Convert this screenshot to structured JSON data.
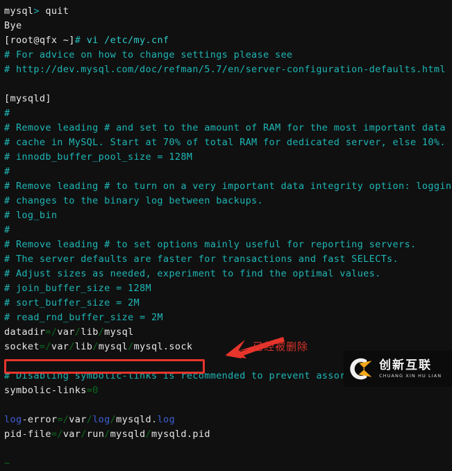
{
  "terminal": {
    "background_color": "#101010",
    "colors": {
      "white": "#e8e8e8",
      "teal_comment": "#1fb7b7",
      "cyan": "#2ecccc",
      "green_separator": "#0c6b1d",
      "blue_keyword": "#3f5fd6",
      "annotation_red": "#e8352c"
    },
    "lines": [
      {
        "id": "l01",
        "segments": [
          {
            "t": "mysql",
            "c": "white"
          },
          {
            "t": ">",
            "c": "teal"
          },
          {
            "t": " quit",
            "c": "white"
          }
        ]
      },
      {
        "id": "l02",
        "segments": [
          {
            "t": "Bye",
            "c": "white"
          }
        ]
      },
      {
        "id": "l03",
        "segments": [
          {
            "t": "[root@qfx ~]",
            "c": "white"
          },
          {
            "t": "#",
            "c": "teal"
          },
          {
            "t": " vi ",
            "c": "cyan"
          },
          {
            "t": "/etc/my.cnf",
            "c": "cyan"
          }
        ]
      },
      {
        "id": "l04",
        "segments": [
          {
            "t": "# For advice on how to change settings please see",
            "c": "teal"
          }
        ]
      },
      {
        "id": "l05",
        "segments": [
          {
            "t": "# http://dev.mysql.com/doc/refman/5.7/en/server-configuration-defaults.html",
            "c": "teal"
          }
        ]
      },
      {
        "id": "l06",
        "segments": [
          {
            "t": "",
            "c": "white"
          }
        ]
      },
      {
        "id": "l07",
        "segments": [
          {
            "t": "[mysqld]",
            "c": "white"
          }
        ]
      },
      {
        "id": "l08",
        "segments": [
          {
            "t": "#",
            "c": "teal"
          }
        ]
      },
      {
        "id": "l09",
        "segments": [
          {
            "t": "# Remove leading # and set to the amount of RAM for the most important data",
            "c": "teal"
          }
        ]
      },
      {
        "id": "l10",
        "segments": [
          {
            "t": "# cache in MySQL. Start at 70% of total RAM for dedicated server, else 10%.",
            "c": "teal"
          }
        ]
      },
      {
        "id": "l11",
        "segments": [
          {
            "t": "# innodb_buffer_pool_size = 128M",
            "c": "teal"
          }
        ]
      },
      {
        "id": "l12",
        "segments": [
          {
            "t": "#",
            "c": "teal"
          }
        ]
      },
      {
        "id": "l13",
        "segments": [
          {
            "t": "# Remove leading # to turn on a very important data integrity option: logging",
            "c": "teal"
          }
        ]
      },
      {
        "id": "l14",
        "segments": [
          {
            "t": "# changes to the binary log between backups.",
            "c": "teal"
          }
        ]
      },
      {
        "id": "l15",
        "segments": [
          {
            "t": "# log_bin",
            "c": "teal"
          }
        ]
      },
      {
        "id": "l16",
        "segments": [
          {
            "t": "#",
            "c": "teal"
          }
        ]
      },
      {
        "id": "l17",
        "segments": [
          {
            "t": "# Remove leading # to set options mainly useful for reporting servers.",
            "c": "teal"
          }
        ]
      },
      {
        "id": "l18",
        "segments": [
          {
            "t": "# The server defaults are faster for transactions and fast SELECTs.",
            "c": "teal"
          }
        ]
      },
      {
        "id": "l19",
        "segments": [
          {
            "t": "# Adjust sizes as needed, experiment to find the optimal values.",
            "c": "teal"
          }
        ]
      },
      {
        "id": "l20",
        "segments": [
          {
            "t": "# join_buffer_size = 128M",
            "c": "teal"
          }
        ]
      },
      {
        "id": "l21",
        "segments": [
          {
            "t": "# sort_buffer_size = 2M",
            "c": "teal"
          }
        ]
      },
      {
        "id": "l22",
        "segments": [
          {
            "t": "# read_rnd_buffer_size = 2M",
            "c": "teal"
          }
        ]
      },
      {
        "id": "l23",
        "segments": [
          {
            "t": "datadir",
            "c": "white"
          },
          {
            "t": "=",
            "c": "green"
          },
          {
            "t": "/",
            "c": "green"
          },
          {
            "t": "var",
            "c": "white"
          },
          {
            "t": "/",
            "c": "green"
          },
          {
            "t": "lib",
            "c": "white"
          },
          {
            "t": "/",
            "c": "green"
          },
          {
            "t": "mysql",
            "c": "white"
          }
        ]
      },
      {
        "id": "l24",
        "segments": [
          {
            "t": "socket",
            "c": "white"
          },
          {
            "t": "=",
            "c": "green"
          },
          {
            "t": "/",
            "c": "green"
          },
          {
            "t": "var",
            "c": "white"
          },
          {
            "t": "/",
            "c": "green"
          },
          {
            "t": "lib",
            "c": "white"
          },
          {
            "t": "/",
            "c": "green"
          },
          {
            "t": "mysql",
            "c": "white"
          },
          {
            "t": "/",
            "c": "green"
          },
          {
            "t": "mysql.sock",
            "c": "white"
          }
        ]
      },
      {
        "id": "l25",
        "segments": [
          {
            "t": "",
            "c": "white"
          }
        ]
      },
      {
        "id": "l26",
        "segments": [
          {
            "t": "# Disabling symbolic-links is recommended to prevent assorted security risks",
            "c": "teal"
          }
        ]
      },
      {
        "id": "l27",
        "segments": [
          {
            "t": "symbolic-links",
            "c": "white"
          },
          {
            "t": "=",
            "c": "green"
          },
          {
            "t": "0",
            "c": "green"
          }
        ]
      },
      {
        "id": "l28",
        "segments": [
          {
            "t": "",
            "c": "white"
          }
        ]
      },
      {
        "id": "l29",
        "segments": [
          {
            "t": "log",
            "c": "blue"
          },
          {
            "t": "-",
            "c": "dim"
          },
          {
            "t": "error",
            "c": "white"
          },
          {
            "t": "=",
            "c": "green"
          },
          {
            "t": "/",
            "c": "green"
          },
          {
            "t": "var",
            "c": "white"
          },
          {
            "t": "/",
            "c": "green"
          },
          {
            "t": "log",
            "c": "blue"
          },
          {
            "t": "/",
            "c": "green"
          },
          {
            "t": "mysqld",
            "c": "white"
          },
          {
            "t": ".",
            "c": "dim"
          },
          {
            "t": "log",
            "c": "blue"
          }
        ]
      },
      {
        "id": "l30",
        "segments": [
          {
            "t": "pid",
            "c": "white"
          },
          {
            "t": "-",
            "c": "dim"
          },
          {
            "t": "file",
            "c": "white"
          },
          {
            "t": "=",
            "c": "green"
          },
          {
            "t": "/",
            "c": "green"
          },
          {
            "t": "var",
            "c": "white"
          },
          {
            "t": "/",
            "c": "green"
          },
          {
            "t": "run",
            "c": "white"
          },
          {
            "t": "/",
            "c": "green"
          },
          {
            "t": "mysqld",
            "c": "white"
          },
          {
            "t": "/",
            "c": "green"
          },
          {
            "t": "mysqld.pid",
            "c": "white"
          }
        ]
      },
      {
        "id": "l31",
        "segments": [
          {
            "t": "",
            "c": "white"
          }
        ]
      },
      {
        "id": "l32",
        "segments": [
          {
            "t": "~",
            "c": "green"
          }
        ]
      }
    ]
  },
  "annotation": {
    "callout_text": "已经被删除",
    "highlight_box_label": "empty-line-highlight"
  },
  "watermark": {
    "chinese": "创新互联",
    "pinyin": "CHUANG XIN HU LIAN",
    "logo_letters": "CX"
  }
}
